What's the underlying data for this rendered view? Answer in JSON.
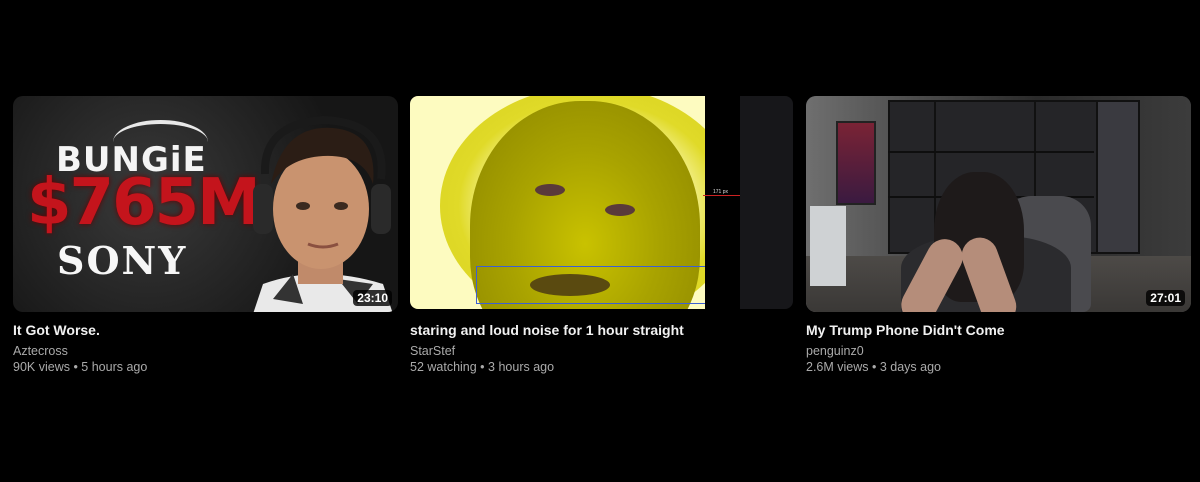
{
  "videos": [
    {
      "title": "It Got Worse.",
      "channel": "Aztecross",
      "meta": "90K views • 5 hours ago",
      "duration": "23:10",
      "thumb_text": {
        "brand": "BUNGiE",
        "amount": "$765M",
        "company": "SONY"
      }
    },
    {
      "title": "staring and loud noise for 1 hour straight",
      "channel": "StarStef",
      "meta": "52 watching • 3 hours ago",
      "marker_label": "171 px"
    },
    {
      "title": "My Trump Phone Didn't Come",
      "channel": "penguinz0",
      "meta": "2.6M views • 3 days ago",
      "duration": "27:01"
    }
  ],
  "colors": {
    "background": "#000000",
    "title": "#f1f1f1",
    "secondary": "#aaaaaa",
    "accent_red": "#c4141c"
  }
}
